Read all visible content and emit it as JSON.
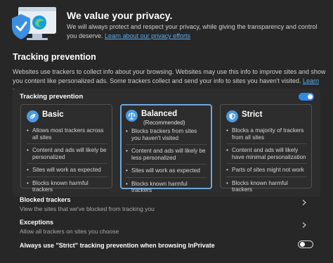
{
  "hero": {
    "title": "We value your privacy.",
    "text": "We will always protect and respect your privacy, while giving the transparency and control you deserve.",
    "link": "Learn about our privacy efforts"
  },
  "tracking": {
    "section_title": "Tracking prevention",
    "description": "Websites use trackers to collect info about your browsing. Websites may use this info to improve sites and show you content like personalized ads. Some trackers collect and send your info to sites you haven't visited.",
    "learn_more": "Learn more",
    "panel_label": "Tracking prevention",
    "toggle_on": true,
    "options": [
      {
        "name": "Basic",
        "subtitle": "",
        "selected": false,
        "bullets": [
          "Allows most trackers across all sites",
          "Content and ads will likely be personalized",
          "Sites will work as expected",
          "Blocks known harmful trackers"
        ]
      },
      {
        "name": "Balanced",
        "subtitle": "(Recommended)",
        "selected": true,
        "bullets": [
          "Blocks trackers from sites you haven't visited",
          "Content and ads will likely be less personalized",
          "Sites will work as expected",
          "Blocks known harmful trackers"
        ]
      },
      {
        "name": "Strict",
        "subtitle": "",
        "selected": false,
        "bullets": [
          "Blocks a majority of trackers from all sites",
          "Content and ads will likely have minimal personalization",
          "Parts of sites might not work",
          "Blocks known harmful trackers"
        ]
      }
    ]
  },
  "blocked": {
    "title": "Blocked trackers",
    "subtitle": "View the sites that we've blocked from tracking you"
  },
  "exceptions": {
    "title": "Exceptions",
    "subtitle": "Allow all trackers on sites you choose"
  },
  "inprivate": {
    "label": "Always use \"Strict\" tracking prevention when browsing InPrivate",
    "toggle_on": false
  },
  "colors": {
    "background": "#272727",
    "panel": "#2d2d2d",
    "accent": "#2f8ae6",
    "link": "#5ab0f0",
    "selected_border": "#6aa9de"
  },
  "icons": {
    "hero": "privacy-shield-illustration",
    "basic": "leaf-icon",
    "balanced": "scales-icon",
    "strict": "shield-icon",
    "chevron": "chevron-right-icon"
  }
}
